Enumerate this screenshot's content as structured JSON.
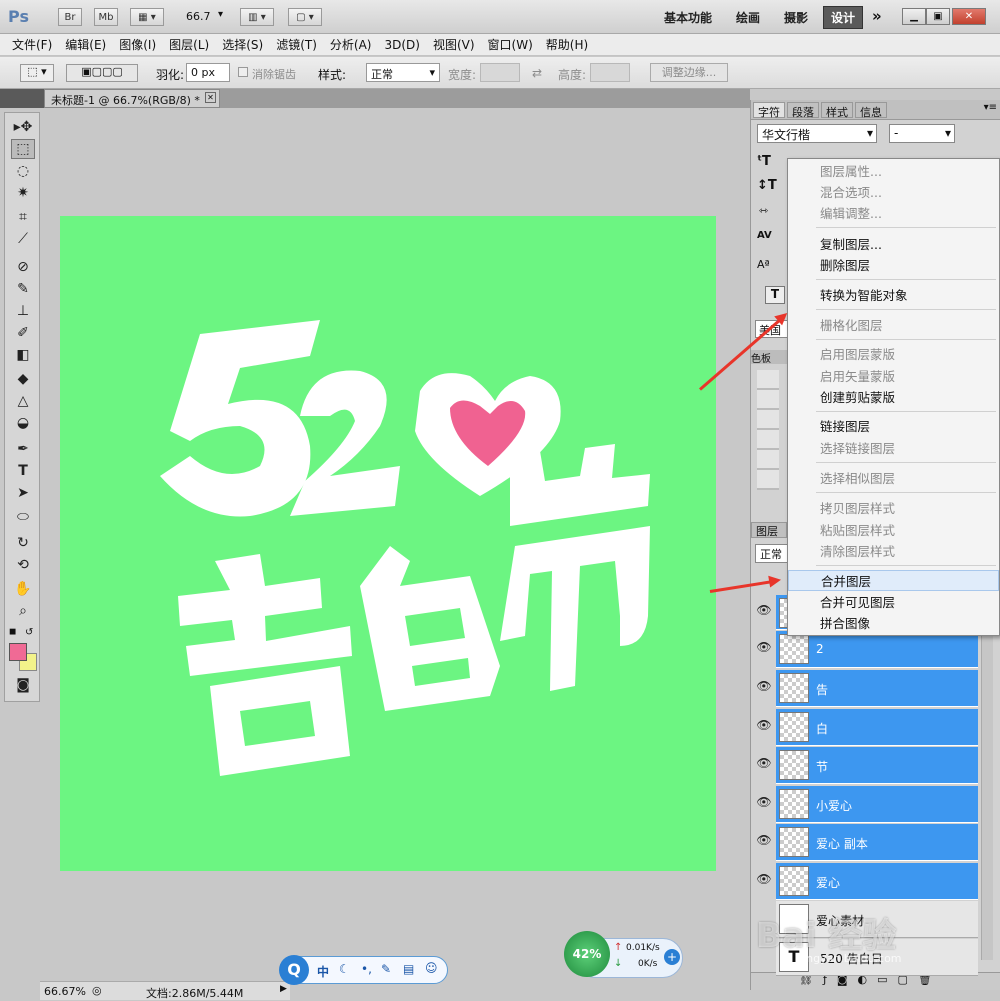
{
  "app": {
    "logo": "Ps"
  },
  "titlebar": {
    "bridge_label": "Br",
    "minibridge_label": "Mb",
    "zoom_value": "66.7",
    "workspaces": [
      "基本功能",
      "绘画",
      "摄影",
      "设计"
    ],
    "active_workspace": "设计",
    "more_label": "»"
  },
  "menu": [
    "文件(F)",
    "编辑(E)",
    "图像(I)",
    "图层(L)",
    "选择(S)",
    "滤镜(T)",
    "分析(A)",
    "3D(D)",
    "视图(V)",
    "窗口(W)",
    "帮助(H)"
  ],
  "options": {
    "feather_label": "羽化:",
    "feather_value": "0 px",
    "antialias_label": "消除锯齿",
    "style_label": "样式:",
    "style_value": "正常",
    "width_label": "宽度:",
    "height_label": "高度:",
    "refine_edge_label": "调整边缘..."
  },
  "document": {
    "tab_title": "未标题-1 @ 66.7%(RGB/8) *",
    "canvas_color": "#6cf582",
    "artwork_text_top": "52",
    "artwork_text_bottom": "告白节",
    "heart_color": "#f06291"
  },
  "status": {
    "zoom": "66.67%",
    "doc_info": "文档:2.86M/5.44M"
  },
  "character_panel": {
    "tabs": [
      "字符",
      "段落",
      "样式",
      "信息"
    ],
    "font_family": "华文行楷",
    "font_style": "-",
    "language": "美国"
  },
  "layers_panel": {
    "tabs": [
      "图层"
    ],
    "blend_mode": "正常",
    "layers": [
      "2",
      "告",
      "白",
      "节",
      "小爱心",
      "爱心 副本",
      "爱心"
    ],
    "bottom_layers": [
      "爱心素材",
      "520 告白日"
    ]
  },
  "context_menu": {
    "items": [
      {
        "label": "图层属性...",
        "disabled": true
      },
      {
        "label": "混合选项...",
        "disabled": true
      },
      {
        "label": "编辑调整...",
        "disabled": true
      },
      {
        "label": "复制图层...",
        "disabled": false
      },
      {
        "label": "删除图层",
        "disabled": false
      },
      {
        "label": "转换为智能对象",
        "disabled": false
      },
      {
        "label": "栅格化图层",
        "disabled": true
      },
      {
        "label": "启用图层蒙版",
        "disabled": true
      },
      {
        "label": "启用矢量蒙版",
        "disabled": true
      },
      {
        "label": "创建剪贴蒙版",
        "disabled": false
      },
      {
        "label": "链接图层",
        "disabled": false
      },
      {
        "label": "选择链接图层",
        "disabled": true
      },
      {
        "label": "选择相似图层",
        "disabled": true
      },
      {
        "label": "拷贝图层样式",
        "disabled": true
      },
      {
        "label": "粘贴图层样式",
        "disabled": true
      },
      {
        "label": "清除图层样式",
        "disabled": true
      },
      {
        "label": "合并图层",
        "disabled": false
      },
      {
        "label": "合并可见图层",
        "disabled": false
      },
      {
        "label": "拼合图像",
        "disabled": false
      }
    ],
    "highlighted": "合并图层"
  },
  "taskbar_widget": {
    "cpu_percent": "42%",
    "up_speed": "0.01K/s",
    "down_speed": "0K/s",
    "ime_chars": [
      "中"
    ]
  },
  "watermark": {
    "text": "Bai 经验",
    "url": "jingyan.baidu.com"
  },
  "colors": {
    "foreground": "#f06a95",
    "background": "#f2f28a",
    "selection": "#3d97f0",
    "annotation_arrow": "#e8352a"
  }
}
